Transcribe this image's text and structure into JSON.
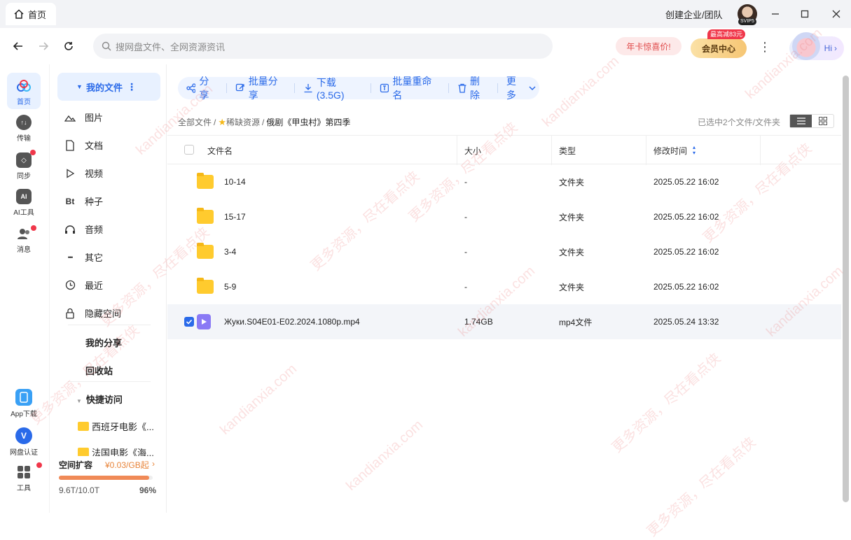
{
  "titlebar": {
    "tab_label": "首页",
    "org_label": "创建企业/团队",
    "svip_badge": "SVIP5"
  },
  "search": {
    "placeholder": "搜网盘文件、全网资源资讯"
  },
  "promo": {
    "label": "年卡惊喜价!"
  },
  "vip": {
    "label": "会员中心",
    "badge": "最高减83元"
  },
  "hi": {
    "label": "Hi"
  },
  "rail": {
    "items": [
      {
        "label": "首页",
        "icon": "cloud-icon"
      },
      {
        "label": "传输",
        "icon": "transfer-icon"
      },
      {
        "label": "同步",
        "icon": "sync-icon"
      },
      {
        "label": "AI工具",
        "icon": "ai-icon"
      },
      {
        "label": "消息",
        "icon": "message-icon"
      },
      {
        "label": "App下载",
        "icon": "phone-icon"
      },
      {
        "label": "网盘认证",
        "icon": "verify-icon"
      },
      {
        "label": "工具",
        "icon": "tools-icon"
      }
    ]
  },
  "sidebar": {
    "my_files": "我的文件",
    "items": [
      {
        "label": "图片",
        "icon": "image-icon"
      },
      {
        "label": "文档",
        "icon": "document-icon"
      },
      {
        "label": "视频",
        "icon": "video-icon"
      },
      {
        "label": "种子",
        "icon": "torrent-icon",
        "glyph": "Bt"
      },
      {
        "label": "音频",
        "icon": "headphone-icon"
      },
      {
        "label": "其它",
        "icon": "more-icon",
        "glyph": "•••"
      },
      {
        "label": "最近",
        "icon": "clock-icon"
      },
      {
        "label": "隐藏空间",
        "icon": "lock-icon"
      }
    ],
    "my_share": "我的分享",
    "recycle": "回收站",
    "quick_access": "快捷访问",
    "quick_items": [
      "西班牙电影《...",
      "法国电影《海..."
    ],
    "storage": {
      "label": "空间扩容",
      "price": "¥0.03/GB起",
      "usage": "9.6T/10.0T",
      "percent_label": "96%",
      "fraction": 0.96
    }
  },
  "actions": [
    {
      "label": "分享",
      "icon": "share-icon"
    },
    {
      "label": "批量分享",
      "icon": "batch-share-icon"
    },
    {
      "label": "下载(3.5G)",
      "icon": "download-icon"
    },
    {
      "label": "批量重命名",
      "icon": "rename-icon"
    },
    {
      "label": "删除",
      "icon": "trash-icon"
    },
    {
      "label": "更多",
      "icon": "chevron-down-icon"
    }
  ],
  "breadcrumb": {
    "root": "全部文件",
    "sep": "/",
    "mid": "稀缺资源",
    "current": "俄剧《甲虫村》第四季"
  },
  "selection_info": "已选中2个文件/文件夹",
  "table": {
    "headers": {
      "name": "文件名",
      "size": "大小",
      "type": "类型",
      "mtime": "修改时间"
    },
    "rows": [
      {
        "name": "10-14",
        "size": "-",
        "type": "文件夹",
        "mtime": "2025.05.22 16:02",
        "kind": "folder",
        "selected": false
      },
      {
        "name": "15-17",
        "size": "-",
        "type": "文件夹",
        "mtime": "2025.05.22 16:02",
        "kind": "folder",
        "selected": false
      },
      {
        "name": "3-4",
        "size": "-",
        "type": "文件夹",
        "mtime": "2025.05.22 16:02",
        "kind": "folder",
        "selected": false
      },
      {
        "name": "5-9",
        "size": "-",
        "type": "文件夹",
        "mtime": "2025.05.22 16:02",
        "kind": "folder",
        "selected": false
      },
      {
        "name": "Жуки.S04E01-E02.2024.1080p.mp4",
        "size": "1.74GB",
        "type": "mp4文件",
        "mtime": "2025.05.24 13:32",
        "kind": "video",
        "selected": true
      }
    ]
  },
  "watermark": {
    "text1": "kandianxia.com",
    "text2": "更多资源，尽在看点侠"
  }
}
